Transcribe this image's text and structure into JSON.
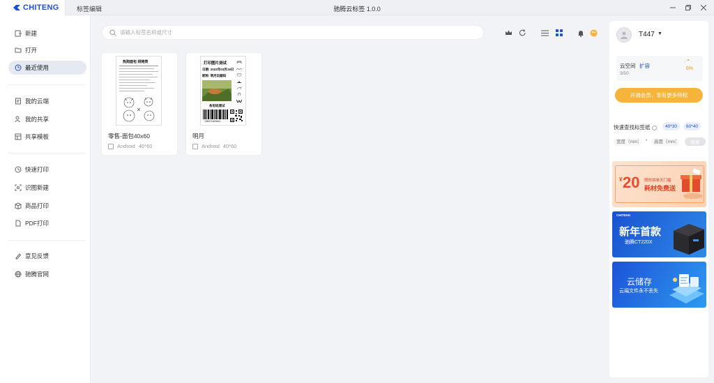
{
  "app": {
    "logo": "CHITENG",
    "tab_editor": "标签编辑",
    "title": "驰腾云标签 1.0.0",
    "window_controls": [
      "minimize-icon",
      "restore-icon",
      "close-icon"
    ]
  },
  "sidebar": {
    "items": [
      {
        "label": "新建",
        "icon": "new-file-icon"
      },
      {
        "label": "打开",
        "icon": "folder-icon"
      },
      {
        "label": "最近使用",
        "icon": "clock-icon",
        "active": true
      },
      {
        "label": "我的云端",
        "icon": "cloud-file-icon"
      },
      {
        "label": "我的共享",
        "icon": "share-user-icon"
      },
      {
        "label": "共享模板",
        "icon": "template-icon"
      },
      {
        "label": "快速打印",
        "icon": "quick-print-icon"
      },
      {
        "label": "识图新建",
        "icon": "scan-icon"
      },
      {
        "label": "商品打印",
        "icon": "box-icon"
      },
      {
        "label": "PDF打印",
        "icon": "pdf-icon"
      },
      {
        "label": "意见反馈",
        "icon": "pen-icon"
      },
      {
        "label": "驰腾官网",
        "icon": "globe-icon"
      }
    ]
  },
  "search": {
    "placeholder": "请输入标签名称或尺寸"
  },
  "toolbar": {
    "icons": [
      "crown-icon",
      "refresh-icon",
      "list-view-icon",
      "grid-view-icon",
      "bell-icon",
      "skin-icon"
    ]
  },
  "cards": [
    {
      "name": "零售-面包40x60",
      "platform": "Android",
      "size": "40*60",
      "thumb": {
        "title": "热狗面包 烘烤类"
      }
    },
    {
      "name": "明月",
      "platform": "Android",
      "size": "40*60",
      "thumb": {
        "title": "打印图片测试",
        "date": "日期: 2022年03月19日",
        "caption": "昵称: 明月玩截码",
        "barcode_title": "条形码测试",
        "barcode_number": "138371849461"
      }
    }
  ],
  "user": {
    "name": "T447",
    "cloud_label": "云空间",
    "expand_label": "扩容",
    "used": "3/50",
    "percent": "6%",
    "vip_button": "开通会员，享有更多特权"
  },
  "quick_find": {
    "title": "快速查找标签纸",
    "chips": [
      "40*30",
      "60*40"
    ],
    "width_placeholder": "宽度（mm）",
    "separator": "*",
    "height_placeholder": "高度（mm）",
    "search_button": "搜索"
  },
  "banners": [
    {
      "amount": "20",
      "headline": "限时拼单无门槛",
      "subline": "耗材免费送"
    },
    {
      "brand": "CHITENG",
      "headline": "新年首款",
      "subline": "驰腾CT220X"
    },
    {
      "headline": "云储存",
      "subline": "云端文件永不丢失"
    }
  ],
  "colors": {
    "accent": "#1d4fd8",
    "vip": "#f7b43a",
    "percent": "#f39b11"
  }
}
